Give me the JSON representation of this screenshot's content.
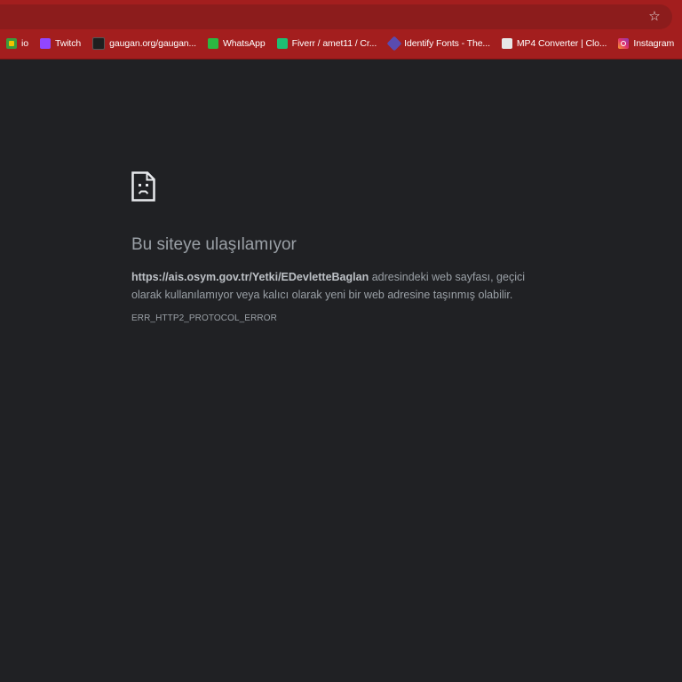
{
  "browser": {
    "star_icon": "star-outline-icon",
    "bookmarks": [
      {
        "label": "io",
        "icon": "io-favicon"
      },
      {
        "label": "Twitch",
        "icon": "twitch-favicon"
      },
      {
        "label": "gaugan.org/gaugan...",
        "icon": "gaugan-favicon"
      },
      {
        "label": "WhatsApp",
        "icon": "whatsapp-favicon"
      },
      {
        "label": "Fiverr / amet11 / Cr...",
        "icon": "fiverr-favicon"
      },
      {
        "label": "Identify Fonts - The...",
        "icon": "fonts-favicon"
      },
      {
        "label": "MP4 Converter | Clo...",
        "icon": "cloud-favicon"
      },
      {
        "label": "Instagram",
        "icon": "instagram-favicon"
      }
    ]
  },
  "error": {
    "title": "Bu siteye ulaşılamıyor",
    "url": "https://ais.osym.gov.tr/Yetki/EDevletteBaglan",
    "description": " adresindeki web sayfası, geçici olarak kullanılamıyor veya kalıcı olarak yeni bir web adresine taşınmış olabilir.",
    "code": "ERR_HTTP2_PROTOCOL_ERROR"
  },
  "colors": {
    "frame": "#a31e1e",
    "background": "#202124",
    "text": "#9aa0a6"
  }
}
